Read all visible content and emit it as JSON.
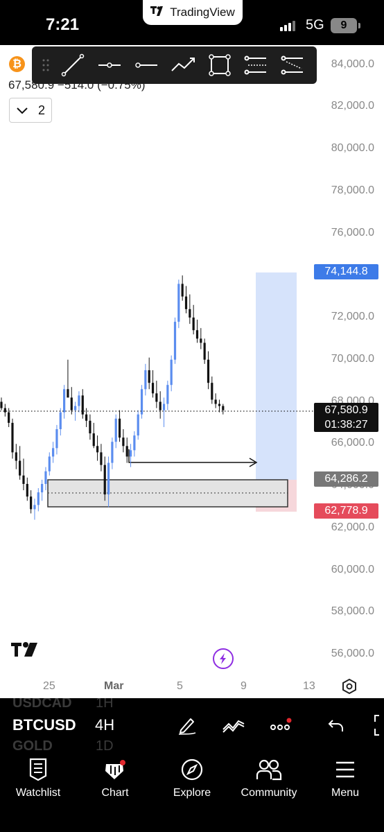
{
  "status": {
    "time": "7:21",
    "app_pill": "TradingView",
    "network": "5G",
    "battery": "9"
  },
  "symbol": {
    "icon_letter": "₿",
    "quote_line": "67,580.9 −514.0 (−0.75%)",
    "collapse_count": "2"
  },
  "drawing_tools": [
    "trend-line-icon",
    "horizontal-ray-icon",
    "ray-icon",
    "path-icon",
    "rectangle-icon",
    "parallel-channel-icon",
    "regression-channel-icon"
  ],
  "price_axis": {
    "ticks": [
      "84,000.0",
      "82,000.0",
      "80,000.0",
      "78,000.0",
      "76,000.0",
      "74,000.0",
      "72,000.0",
      "70,000.0",
      "68,000.0",
      "66,000.0",
      "64,000.0",
      "62,000.0",
      "60,000.0",
      "58,000.0",
      "56,000.0"
    ],
    "target_label": "74,144.8",
    "current_price": "67,580.9",
    "countdown": "01:38:27",
    "entry_label": "64,286.2",
    "stop_label": "62,778.9",
    "colors": {
      "target": "#3d7be8",
      "entry": "#777777",
      "stop": "#e54b5b"
    }
  },
  "time_axis": {
    "ticks": [
      {
        "label": "25",
        "bold": false
      },
      {
        "label": "Mar",
        "bold": true
      },
      {
        "label": "5",
        "bold": false
      },
      {
        "label": "9",
        "bold": false
      },
      {
        "label": "13",
        "bold": false
      }
    ]
  },
  "toolbar": {
    "symbol": "BTCUSD",
    "interval": "4H",
    "ghost_symbols": [
      "USDCAD",
      "GOLD"
    ],
    "ghost_intervals": [
      "1H",
      "1D"
    ]
  },
  "nav": {
    "items": [
      {
        "label": "Watchlist",
        "icon": "watchlist-icon"
      },
      {
        "label": "Chart",
        "icon": "chart-icon"
      },
      {
        "label": "Explore",
        "icon": "compass-icon"
      },
      {
        "label": "Community",
        "icon": "community-icon"
      },
      {
        "label": "Menu",
        "icon": "menu-icon"
      }
    ]
  },
  "chart_data": {
    "type": "candlestick",
    "symbol": "BTCUSD",
    "interval": "4H",
    "current_price": 67580.9,
    "ylim": [
      55000,
      85000
    ],
    "position": {
      "type": "long",
      "target": 74144.8,
      "entry": 64286.2,
      "stop": 62778.9
    },
    "candles": [
      [
        68000,
        68200,
        67600,
        67700
      ],
      [
        67700,
        67900,
        67300,
        67500
      ],
      [
        67500,
        67700,
        66800,
        67000
      ],
      [
        67000,
        67200,
        65300,
        65600
      ],
      [
        65600,
        66000,
        64800,
        65200
      ],
      [
        65200,
        65900,
        64300,
        64500
      ],
      [
        64500,
        65300,
        63800,
        64100
      ],
      [
        64100,
        64400,
        63300,
        63500
      ],
      [
        63500,
        63800,
        62700,
        62900
      ],
      [
        62900,
        63400,
        62400,
        63100
      ],
      [
        63100,
        63900,
        62800,
        63700
      ],
      [
        63700,
        64300,
        63300,
        64100
      ],
      [
        64100,
        64900,
        63800,
        64700
      ],
      [
        64700,
        65600,
        64500,
        65400
      ],
      [
        65400,
        66100,
        65100,
        65800
      ],
      [
        65800,
        66900,
        65500,
        66700
      ],
      [
        66700,
        67700,
        66400,
        67500
      ],
      [
        67500,
        68800,
        67200,
        68600
      ],
      [
        68600,
        70000,
        68300,
        68200
      ],
      [
        68200,
        68700,
        67400,
        67600
      ],
      [
        67600,
        68000,
        67100,
        67800
      ],
      [
        67800,
        68500,
        67500,
        68300
      ],
      [
        68300,
        68600,
        67200,
        67400
      ],
      [
        67400,
        67700,
        66800,
        67100
      ],
      [
        67100,
        67400,
        66200,
        66500
      ],
      [
        66500,
        67000,
        65800,
        65900
      ],
      [
        65900,
        66400,
        65200,
        65600
      ],
      [
        65600,
        66000,
        64700,
        65000
      ],
      [
        65000,
        65400,
        63300,
        63600
      ],
      [
        63600,
        65400,
        63000,
        65100
      ],
      [
        65100,
        66300,
        64800,
        66100
      ],
      [
        66100,
        67400,
        65800,
        67200
      ],
      [
        67200,
        67600,
        66100,
        66300
      ],
      [
        66300,
        66700,
        65600,
        65900
      ],
      [
        65900,
        66300,
        65100,
        65400
      ],
      [
        65400,
        66000,
        64900,
        65700
      ],
      [
        65700,
        66600,
        65400,
        66400
      ],
      [
        66400,
        67600,
        66200,
        67400
      ],
      [
        67400,
        68800,
        67200,
        68600
      ],
      [
        68600,
        69800,
        68300,
        69500
      ],
      [
        69500,
        70100,
        68600,
        68900
      ],
      [
        68900,
        69500,
        68200,
        68400
      ],
      [
        68400,
        69000,
        67700,
        68000
      ],
      [
        68000,
        68500,
        67200,
        67600
      ],
      [
        67600,
        68200,
        66800,
        67900
      ],
      [
        67900,
        69000,
        67600,
        68800
      ],
      [
        68800,
        70200,
        68500,
        70000
      ],
      [
        70000,
        72000,
        69800,
        71800
      ],
      [
        71800,
        73800,
        71500,
        73600
      ],
      [
        73600,
        74000,
        72800,
        73000
      ],
      [
        73000,
        73500,
        72200,
        72400
      ],
      [
        72400,
        73100,
        71700,
        72000
      ],
      [
        72000,
        72600,
        71200,
        71400
      ],
      [
        71400,
        71900,
        70800,
        71000
      ],
      [
        71000,
        71500,
        70500,
        70800
      ],
      [
        70800,
        71000,
        69800,
        70000
      ],
      [
        70000,
        70400,
        68600,
        68900
      ],
      [
        68900,
        69200,
        67900,
        68100
      ],
      [
        68100,
        68400,
        67700,
        67900
      ],
      [
        67900,
        68100,
        67500,
        67800
      ],
      [
        67800,
        67900,
        67400,
        67600
      ]
    ]
  }
}
